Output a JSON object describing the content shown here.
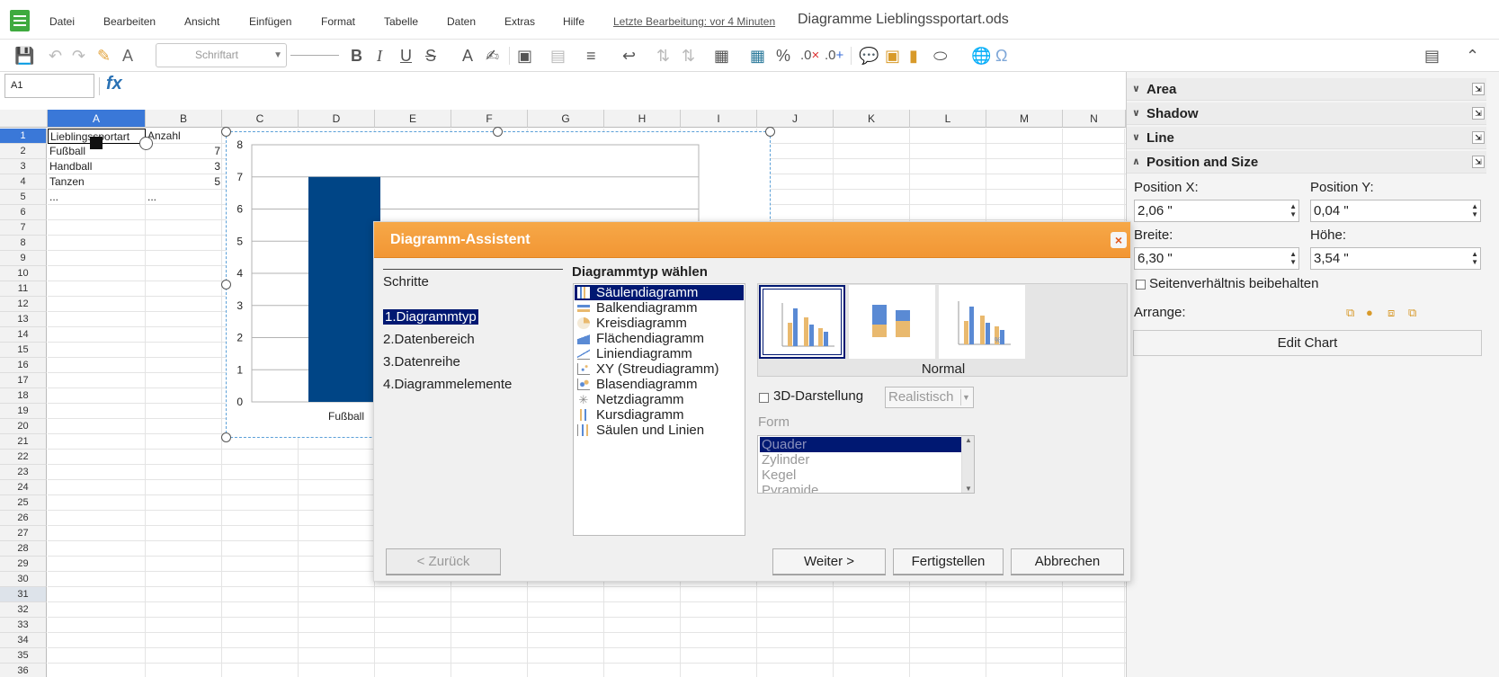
{
  "app": {
    "document_title": "Diagramme Lieblingssportart.ods",
    "last_edit": "Letzte Bearbeitung: vor 4 Minuten"
  },
  "menu": [
    "Datei",
    "Bearbeiten",
    "Ansicht",
    "Einfügen",
    "Format",
    "Tabelle",
    "Daten",
    "Extras",
    "Hilfe"
  ],
  "toolbar": {
    "font_placeholder": "Schriftart",
    "icons": [
      "save-icon",
      "undo-icon",
      "redo-icon",
      "clone-formatting-icon",
      "clear-formatting-icon",
      "bold-icon",
      "italic-icon",
      "underline-icon",
      "strikethrough-icon",
      "font-color-icon",
      "highlight-icon",
      "border-icon",
      "merge-icon",
      "align-icon",
      "wrap-icon",
      "sort-asc-icon",
      "sort-desc-icon",
      "insert-rows-icon",
      "currency-icon",
      "percent-icon",
      "decimal-remove-icon",
      "decimal-add-icon",
      "comment-icon",
      "image-icon",
      "chart-icon",
      "shapes-icon",
      "hyperlink-icon",
      "special-character-icon",
      "sidebar-toggle-icon",
      "collapse-icon"
    ]
  },
  "formula_bar": {
    "name_box": "A1",
    "fx": "fx"
  },
  "sheet": {
    "columns": [
      "A",
      "B",
      "C",
      "D",
      "E",
      "F",
      "G",
      "H",
      "I",
      "J",
      "K",
      "L",
      "M",
      "N"
    ],
    "rows": [
      "1",
      "2",
      "3",
      "4",
      "5",
      "6",
      "7",
      "8",
      "9",
      "10",
      "11",
      "12",
      "13",
      "14",
      "15",
      "16",
      "17",
      "18",
      "19",
      "20",
      "21",
      "22",
      "23",
      "24",
      "25",
      "26",
      "27",
      "28",
      "29",
      "30",
      "31",
      "32",
      "33",
      "34",
      "35",
      "36"
    ],
    "cells": [
      {
        "a": "Lieblingssportart",
        "b": "Anzahl"
      },
      {
        "a": "Fußball",
        "b": "7"
      },
      {
        "a": "Handball",
        "b": "3"
      },
      {
        "a": "Tanzen",
        "b": "5"
      },
      {
        "a": "...",
        "b": "..."
      }
    ]
  },
  "chart_data": {
    "type": "bar",
    "categories": [
      "Fußball"
    ],
    "values": [
      7
    ],
    "ylim": [
      0,
      8
    ],
    "yticks": [
      "0",
      "1",
      "2",
      "3",
      "4",
      "5",
      "6",
      "7",
      "8"
    ],
    "bar_color": "#004586"
  },
  "sidebar": {
    "sections": [
      "Area",
      "Shadow",
      "Line",
      "Position and Size"
    ],
    "position_x_label": "Position X:",
    "position_x": "2,06 \"",
    "position_y_label": "Position Y:",
    "position_y": "0,04 \"",
    "width_label": "Breite:",
    "width": "6,30 \"",
    "height_label": "Höhe:",
    "height": "3,54 \"",
    "keep_ratio": "Seitenverhältnis beibehalten",
    "arrange": "Arrange:",
    "edit_chart": "Edit Chart"
  },
  "dialog": {
    "title": "Diagramm-Assistent",
    "steps_title": "Schritte",
    "steps": [
      {
        "num": "1.",
        "label": "Diagrammtyp"
      },
      {
        "num": "2.",
        "label": "Datenbereich"
      },
      {
        "num": "3.",
        "label": "Datenreihe"
      },
      {
        "num": "4.",
        "label": "Diagrammelemente"
      }
    ],
    "type_heading": "Diagrammtyp wählen",
    "types": [
      "Säulendiagramm",
      "Balkendiagramm",
      "Kreisdiagramm",
      "Flächendiagramm",
      "Liniendiagramm",
      "XY (Streudiagramm)",
      "Blasendiagramm",
      "Netzdiagramm",
      "Kursdiagramm",
      "Säulen und Linien"
    ],
    "variant_label": "Normal",
    "three_d": "3D-Darstellung",
    "realistic": "Realistisch",
    "form_label": "Form",
    "forms": [
      "Quader",
      "Zylinder",
      "Kegel",
      "Pyramide"
    ],
    "buttons": {
      "back": "< Zurück",
      "next": "Weiter >",
      "finish": "Fertigstellen",
      "cancel": "Abbrechen"
    },
    "accent": "#f29634",
    "selection_color": "#001872"
  }
}
